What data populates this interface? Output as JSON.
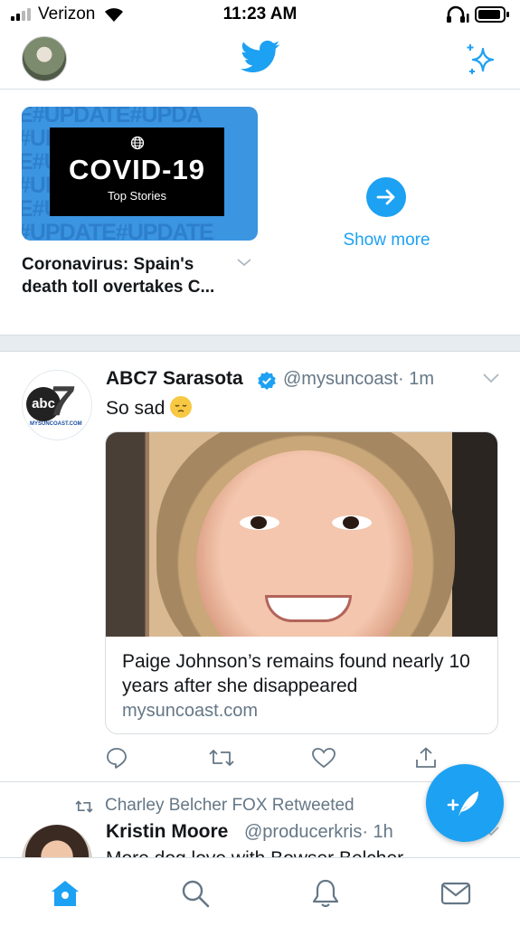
{
  "status_bar": {
    "carrier": "Verizon",
    "time": "11:23 AM"
  },
  "nav": {
    "logo": "twitter-bird-icon",
    "sparkle": "sparkle-icon"
  },
  "explore": {
    "card_background_text": "E#UPDATE#UPDA #UPDATE#UPDATE E#UPDATE#UPDA #UPDATE#UPDATE E#UPDATE#UPDA #UPDATE#UPDATE",
    "card_title": "COVID-19",
    "card_subtitle": "Top Stories",
    "headline": "Coronavirus: Spain's death toll overtakes C...",
    "show_more": "Show more"
  },
  "tweet1": {
    "name": "ABC7 Sarasota",
    "handle": "@mysuncoast",
    "time": "· 1m",
    "text": "So sad",
    "avatar_text": "abc",
    "avatar_number": "7",
    "avatar_sub": "MYSUNCOAST.COM",
    "link_title": "Paige Johnson’s remains found nearly 10 years after she disappeared",
    "link_domain": "mysuncoast.com"
  },
  "tweet2": {
    "retweeted_by": "Charley Belcher FOX Retweeted",
    "name": "Kristin Moore",
    "handle": "@producerkris",
    "time": "· 1h",
    "text": "More dog love with Bowser Belcher"
  },
  "colors": {
    "accent": "#1da1f2",
    "text": "#14171a",
    "muted": "#657786",
    "card_blue": "#3b95e0"
  },
  "tab_bar": [
    "home-icon",
    "search-icon",
    "notifications-icon",
    "messages-icon"
  ]
}
